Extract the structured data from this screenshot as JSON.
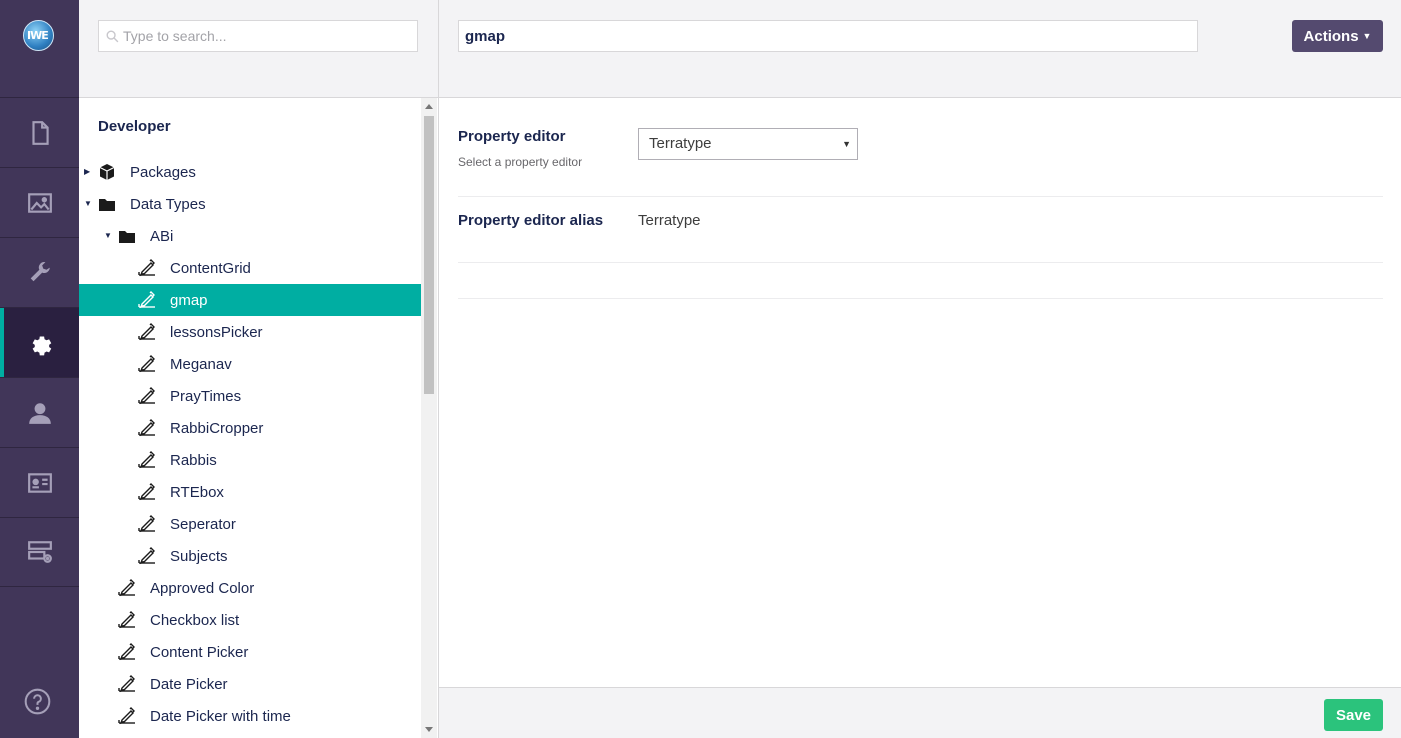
{
  "app": {
    "logo_text": "IWE",
    "sections": [
      {
        "name": "content",
        "icon": "document-icon"
      },
      {
        "name": "media",
        "icon": "image-icon"
      },
      {
        "name": "settings",
        "icon": "wrench-icon"
      },
      {
        "name": "developer",
        "icon": "gear-icon",
        "active": true
      },
      {
        "name": "users",
        "icon": "user-icon"
      },
      {
        "name": "members",
        "icon": "id-card-icon"
      },
      {
        "name": "forms",
        "icon": "forms-icon"
      }
    ],
    "help_icon": "question-icon"
  },
  "tree": {
    "search_placeholder": "Type to search...",
    "root_title": "Developer",
    "items": [
      {
        "label": "Packages",
        "icon": "package-icon",
        "caret": "collapsed",
        "depth": 0
      },
      {
        "label": "Data Types",
        "icon": "folder-icon",
        "caret": "expanded",
        "depth": 0
      },
      {
        "label": "ABi",
        "icon": "folder-icon",
        "caret": "expanded",
        "depth": 1
      },
      {
        "label": "ContentGrid",
        "icon": "datatype-icon",
        "depth": 2
      },
      {
        "label": "gmap",
        "icon": "datatype-icon",
        "depth": 2,
        "selected": true
      },
      {
        "label": "lessonsPicker",
        "icon": "datatype-icon",
        "depth": 2
      },
      {
        "label": "Meganav",
        "icon": "datatype-icon",
        "depth": 2
      },
      {
        "label": "PrayTimes",
        "icon": "datatype-icon",
        "depth": 2
      },
      {
        "label": "RabbiCropper",
        "icon": "datatype-icon",
        "depth": 2
      },
      {
        "label": "Rabbis",
        "icon": "datatype-icon",
        "depth": 2
      },
      {
        "label": "RTEbox",
        "icon": "datatype-icon",
        "depth": 2
      },
      {
        "label": "Seperator",
        "icon": "datatype-icon",
        "depth": 2
      },
      {
        "label": "Subjects",
        "icon": "datatype-icon",
        "depth": 2
      },
      {
        "label": "Approved Color",
        "icon": "datatype-icon",
        "depth": 1
      },
      {
        "label": "Checkbox list",
        "icon": "datatype-icon",
        "depth": 1
      },
      {
        "label": "Content Picker",
        "icon": "datatype-icon",
        "depth": 1
      },
      {
        "label": "Date Picker",
        "icon": "datatype-icon",
        "depth": 1
      },
      {
        "label": "Date Picker with time",
        "icon": "datatype-icon",
        "depth": 1
      }
    ]
  },
  "editor": {
    "name_value": "gmap",
    "actions_label": "Actions",
    "property_editor": {
      "label": "Property editor",
      "description": "Select a property editor",
      "selected": "Terratype"
    },
    "property_editor_alias": {
      "label": "Property editor alias",
      "value": "Terratype"
    },
    "save_label": "Save"
  },
  "colors": {
    "appbar": "#413659",
    "selected": "#00aea2",
    "actions": "#544a6f",
    "save": "#2bc37c"
  }
}
